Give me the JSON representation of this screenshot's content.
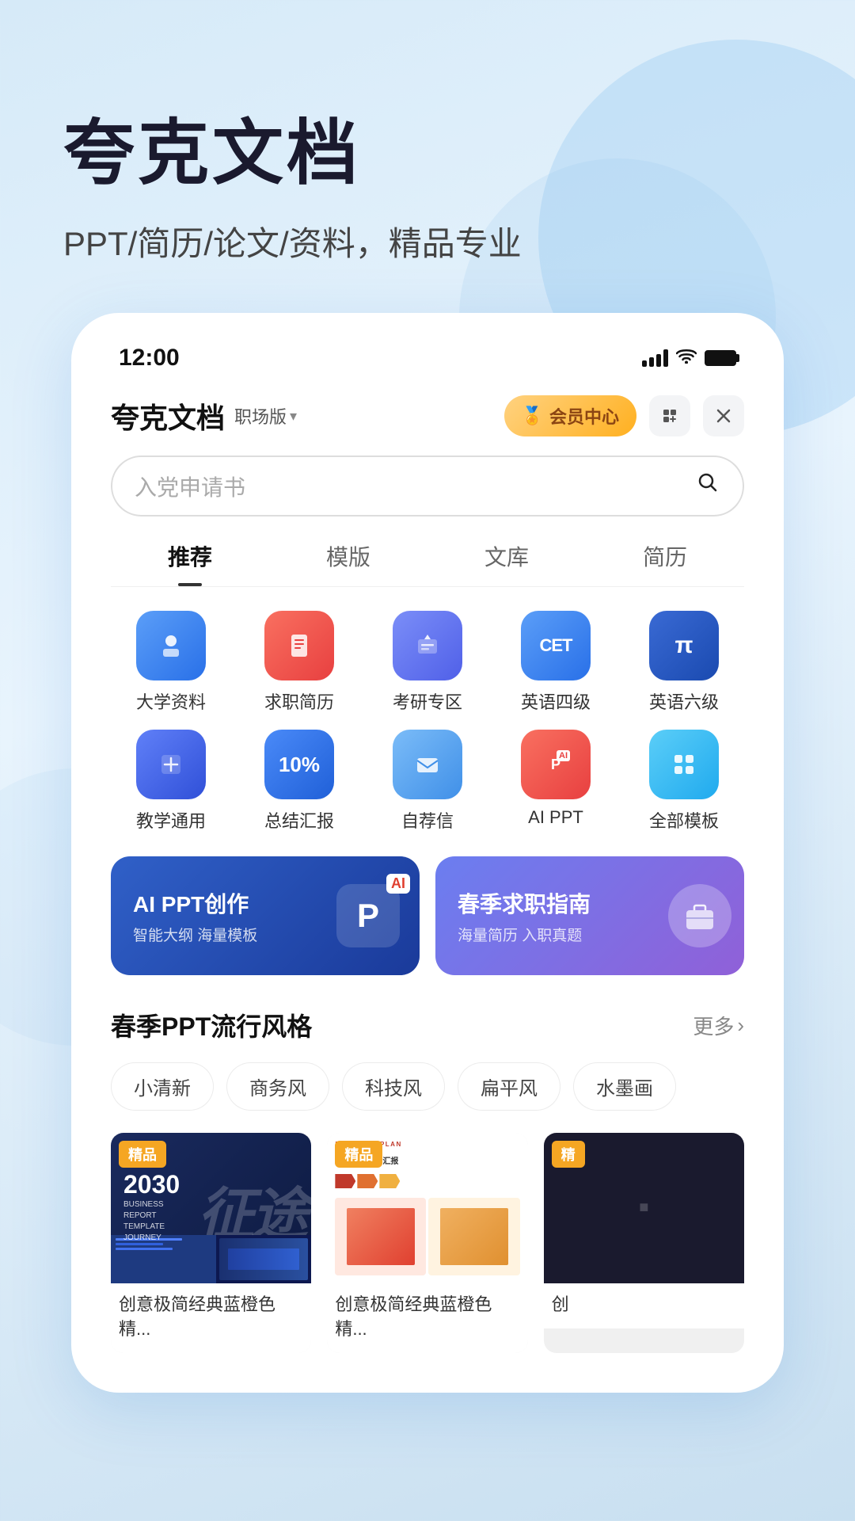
{
  "app": {
    "name": "夸克文档",
    "edition": "职场版",
    "hero_title": "夸克文档",
    "hero_subtitle": "PPT/简历/论文/资料，精品专业"
  },
  "status_bar": {
    "time": "12:00",
    "signal_label": "signal",
    "wifi_label": "wifi",
    "battery_label": "battery"
  },
  "header": {
    "vip_label": "会员中心",
    "add_icon": "＋",
    "close_icon": "×"
  },
  "search": {
    "placeholder": "入党申请书"
  },
  "tabs": [
    {
      "label": "推荐",
      "active": true
    },
    {
      "label": "模版",
      "active": false
    },
    {
      "label": "文库",
      "active": false
    },
    {
      "label": "简历",
      "active": false
    }
  ],
  "icons": [
    {
      "id": "daxue",
      "label": "大学资料",
      "emoji": "📚",
      "color": "ic-daxue"
    },
    {
      "id": "jianzhi",
      "label": "求职简历",
      "emoji": "📄",
      "color": "ic-jianzhi"
    },
    {
      "id": "kaoyan",
      "label": "考研专区",
      "emoji": "🎓",
      "color": "ic-kaoyan"
    },
    {
      "id": "cet4",
      "label": "英语四级",
      "emoji": "CET",
      "color": "ic-cet4"
    },
    {
      "id": "cet6",
      "label": "英语六级",
      "emoji": "π",
      "color": "ic-cet6"
    },
    {
      "id": "jiaoxue",
      "label": "教学通用",
      "emoji": "📝",
      "color": "ic-jiaoxue"
    },
    {
      "id": "zongjie",
      "label": "总结汇报",
      "emoji": "📊",
      "color": "ic-zongjie"
    },
    {
      "id": "zitui",
      "label": "自荐信",
      "emoji": "✉",
      "color": "ic-zitui"
    },
    {
      "id": "aippt",
      "label": "AI PPT",
      "emoji": "P",
      "color": "ic-aippt"
    },
    {
      "id": "all",
      "label": "全部模板",
      "emoji": "⊞",
      "color": "ic-all"
    }
  ],
  "banners": [
    {
      "id": "ai-ppt",
      "title": "AI PPT创作",
      "subtitle": "智能大纲 海量模板"
    },
    {
      "id": "job",
      "title": "春季求职指南",
      "subtitle": "海量简历 入职真题"
    }
  ],
  "trending": {
    "title": "春季PPT流行风格",
    "more_label": "更多",
    "tags": [
      "小清新",
      "商务风",
      "科技风",
      "扁平风",
      "水墨画"
    ]
  },
  "templates": [
    {
      "id": "t1",
      "badge": "精品",
      "name": "创意极简经典蓝橙色精...",
      "year": "2030",
      "report_lines": [
        "BUSINESS",
        "REPORT",
        "TEMPLATE",
        "JOURNEY"
      ]
    },
    {
      "id": "t2",
      "badge": "精品",
      "name": "创意极简经典蓝橙色精...",
      "plan_title": "BUSINESS PLAN",
      "plan_subtitle": "时尚工作总结汇报"
    },
    {
      "id": "t3",
      "badge": "精",
      "name": "创"
    }
  ],
  "colors": {
    "accent_blue": "#2970e8",
    "accent_orange": "#f5a623",
    "accent_red": "#e04030",
    "bg_light": "#d6eaf8"
  }
}
